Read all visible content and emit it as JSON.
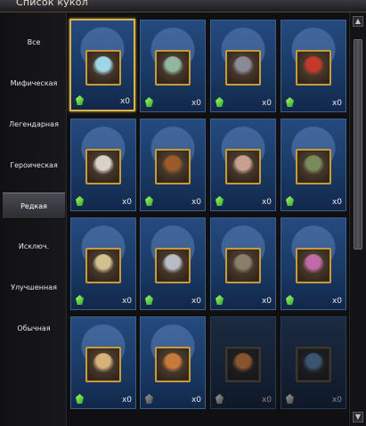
{
  "window": {
    "title": "Список кукол"
  },
  "categories": [
    {
      "label": "Все"
    },
    {
      "label": "Мифическая"
    },
    {
      "label": "Легендарная"
    },
    {
      "label": "Героическая"
    },
    {
      "label": "Редкая",
      "active": true
    },
    {
      "label": "Исключ."
    },
    {
      "label": "Улучшенная"
    },
    {
      "label": "Обычная"
    }
  ],
  "dolls": [
    {
      "count": "x0",
      "tint": "#9fd6e6",
      "selected": true
    },
    {
      "count": "x0",
      "tint": "#8fb6a0"
    },
    {
      "count": "x0",
      "tint": "#8a8a96"
    },
    {
      "count": "x0",
      "tint": "#c23a2a"
    },
    {
      "count": "x0",
      "tint": "#d8d2c8"
    },
    {
      "count": "x0",
      "tint": "#9a5a2a"
    },
    {
      "count": "x0",
      "tint": "#c8a090"
    },
    {
      "count": "x0",
      "tint": "#7a8a5a"
    },
    {
      "count": "x0",
      "tint": "#d2c090"
    },
    {
      "count": "x0",
      "tint": "#b8bcc4"
    },
    {
      "count": "x0",
      "tint": "#8a806a"
    },
    {
      "count": "x0",
      "tint": "#c06aa8"
    },
    {
      "count": "x0",
      "tint": "#d4b27a"
    },
    {
      "count": "x0",
      "tint": "#c87a3a"
    },
    {
      "count": "x0",
      "tint": "#b86a2a",
      "locked": true
    },
    {
      "count": "x0",
      "tint": "#4a6a8a",
      "locked": true
    }
  ],
  "scroll": {
    "up": "▲",
    "down": "▼"
  }
}
